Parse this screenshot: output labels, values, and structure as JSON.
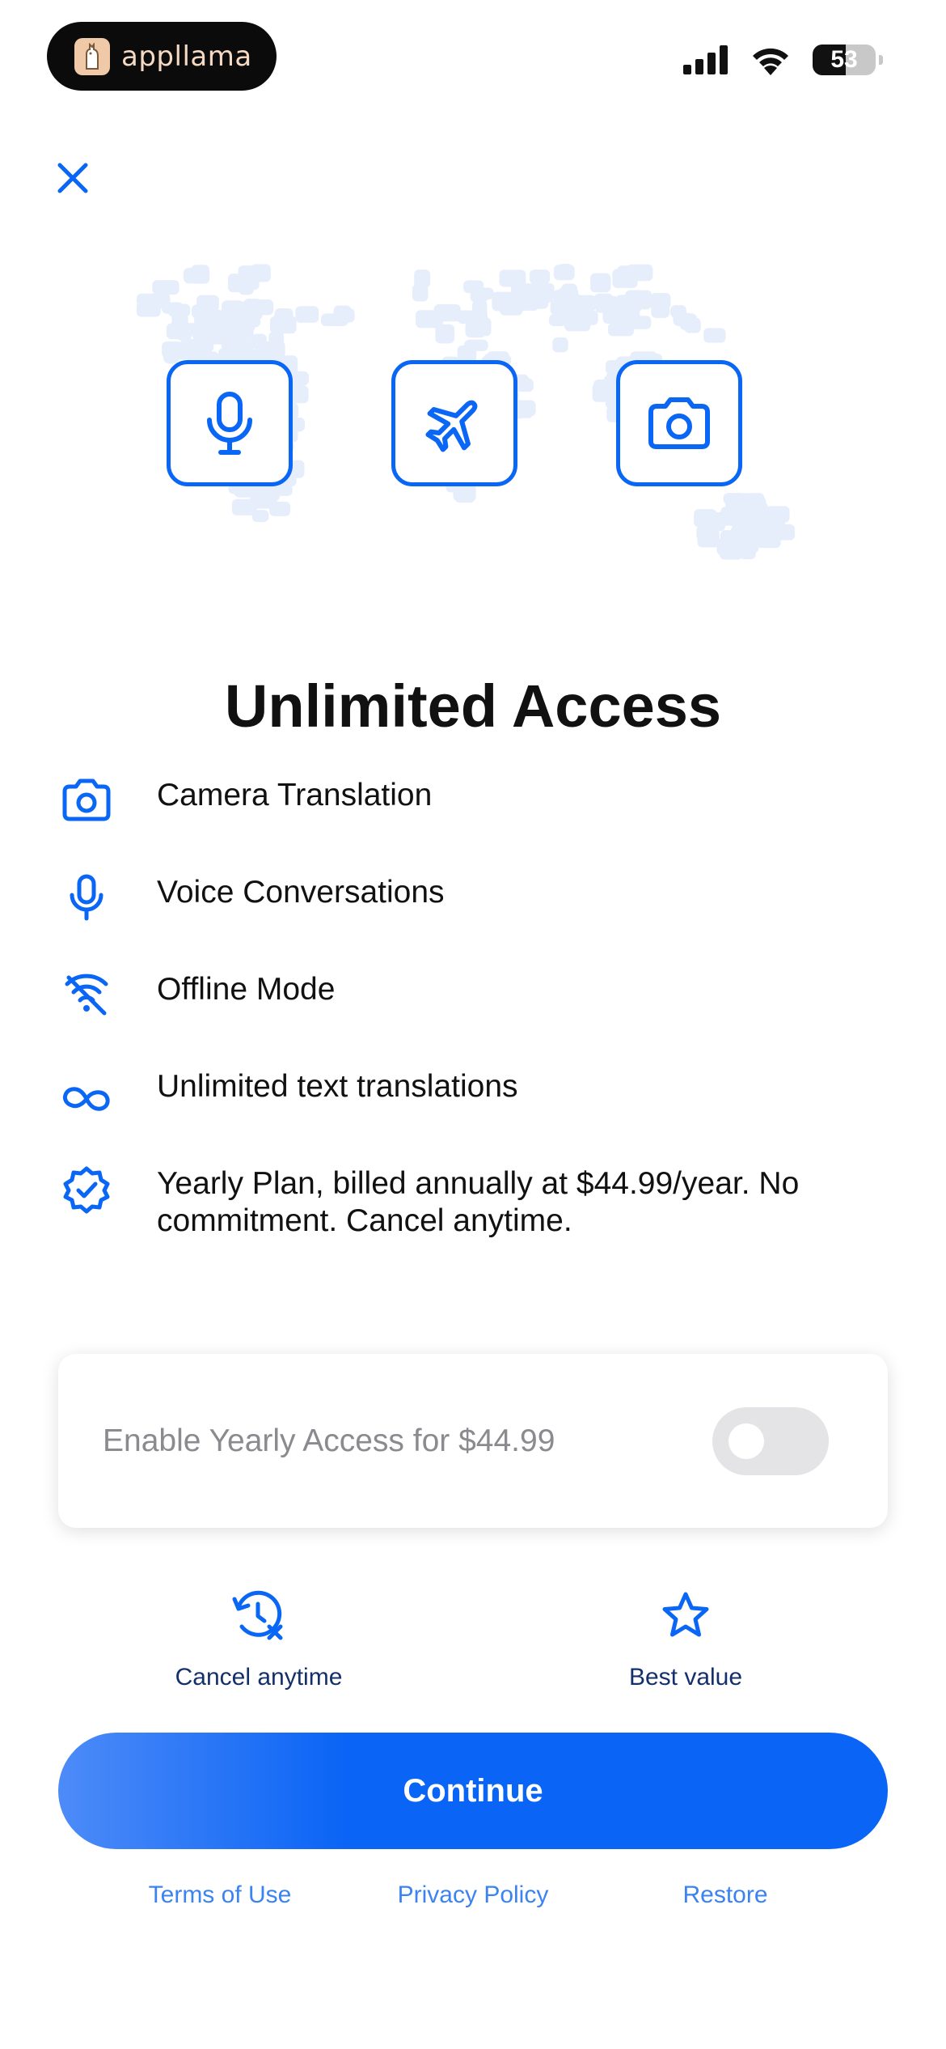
{
  "status_bar": {
    "brand_name": "appllama",
    "battery_level": "53",
    "icons": [
      "cellular-signal-icon",
      "wifi-icon",
      "battery-icon"
    ]
  },
  "close_icon": "close-icon",
  "hero": {
    "icons": [
      "microphone-icon",
      "airplane-icon",
      "camera-icon"
    ],
    "background": "world-map-speech-bubbles"
  },
  "title": "Unlimited Access",
  "features": [
    {
      "icon": "camera-icon",
      "label": "Camera Translation"
    },
    {
      "icon": "microphone-icon",
      "label": "Voice Conversations"
    },
    {
      "icon": "wifi-off-icon",
      "label": "Offline Mode"
    },
    {
      "icon": "infinity-icon",
      "label": "Unlimited text translations"
    },
    {
      "icon": "verified-badge-icon",
      "label": "Yearly Plan, billed annually at $44.99/year. No commitment. Cancel anytime."
    }
  ],
  "toggle": {
    "label": "Enable Yearly Access for $44.99",
    "enabled": false
  },
  "perks": [
    {
      "icon": "history-cancel-icon",
      "label": "Cancel anytime"
    },
    {
      "icon": "star-icon",
      "label": "Best value"
    }
  ],
  "continue_label": "Continue",
  "footer": {
    "terms": "Terms of Use",
    "privacy": "Privacy Policy",
    "restore": "Restore"
  },
  "colors": {
    "accent": "#0a66f5",
    "background": "#ffffff",
    "text": "#111111",
    "muted": "#8a8a8f",
    "map_bubbles": "#e6eefb"
  }
}
